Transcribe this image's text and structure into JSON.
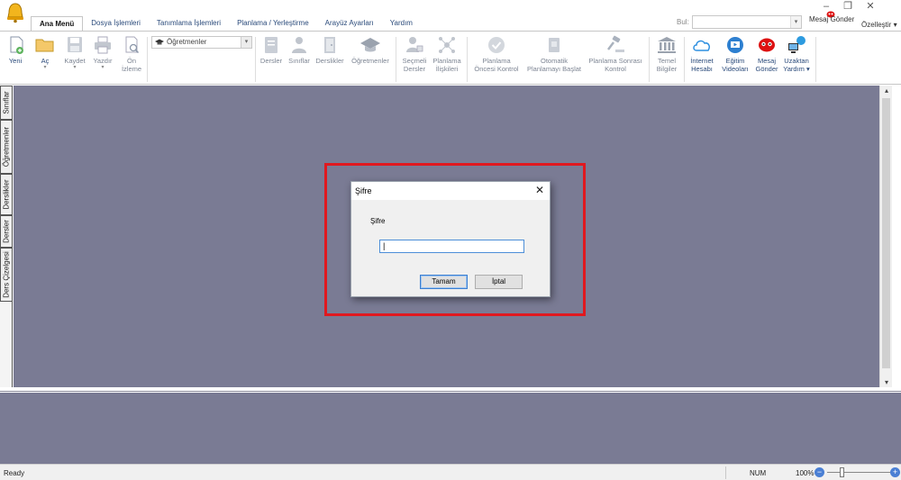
{
  "window": {
    "minimize_glyph": "–",
    "restore_glyph": "❐",
    "close_glyph": "✕"
  },
  "menu_tabs": [
    {
      "label": "Ana Menü",
      "active": true
    },
    {
      "label": "Dosya İşlemleri",
      "active": false
    },
    {
      "label": "Tanımlama İşlemleri",
      "active": false
    },
    {
      "label": "Planlama / Yerleştirme",
      "active": false
    },
    {
      "label": "Arayüz Ayarları",
      "active": false
    },
    {
      "label": "Yardım",
      "active": false
    }
  ],
  "search": {
    "label": "Bul:",
    "value": ""
  },
  "top_right": {
    "message_send": "Mesaj Gönder",
    "customize": "Özelleştir ▾"
  },
  "ribbon": {
    "new": "Yeni",
    "open": "Aç",
    "save": "Kaydet",
    "print": "Yazdır",
    "preview_1": "Ön",
    "preview_2": "İzleme",
    "teacher_combo": "Öğretmenler",
    "lessons": "Dersler",
    "classes": "Sınıflar",
    "classrooms": "Derslikler",
    "teachers": "Öğretmenler",
    "elective_1": "Seçmeli",
    "elective_2": "Dersler",
    "plan_rel_1": "Planlama",
    "plan_rel_2": "İlişkileri",
    "pre_check_1": "Planlama",
    "pre_check_2": "Öncesi Kontrol",
    "auto_plan_1": "Otomatik",
    "auto_plan_2": "Planlamayı Başlat",
    "post_check_1": "Planlama Sonrası",
    "post_check_2": "Kontrol",
    "basic_info_1": "Temel",
    "basic_info_2": "Bilgiler",
    "internet_1": "İnternet",
    "internet_2": "Hesabı",
    "videos_1": "Eğitim",
    "videos_2": "Videoları",
    "message_1": "Mesaj",
    "message_2": "Gönder",
    "remote_1": "Uzaktan",
    "remote_2": "Yardım ▾"
  },
  "side_tabs": [
    "Sınıflar",
    "Öğretmenler",
    "Derslikler",
    "Dersler",
    "Ders Çizelgesi"
  ],
  "status": {
    "ready": "Ready",
    "num": "NUM",
    "zoom": "100%",
    "zoom_level": 1.0
  },
  "dialog": {
    "title": "Şifre",
    "close_glyph": "✕",
    "label": "Şifre",
    "password_value": "",
    "ok": "Tamam",
    "cancel": "İptal"
  },
  "colors": {
    "workspace": "#7a7b94",
    "highlight": "#e0191f",
    "accent": "#2a4a7a"
  }
}
